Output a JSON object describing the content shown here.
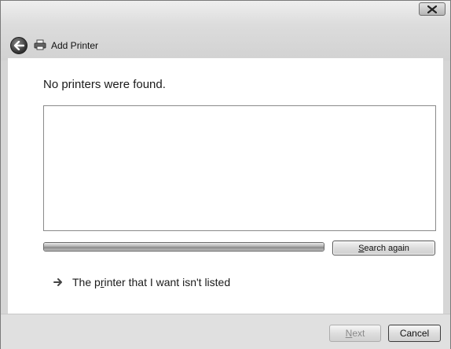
{
  "window": {
    "title": "Add Printer"
  },
  "titlebar": {
    "close_icon": "close-icon",
    "back_icon": "back-arrow-icon",
    "printer_icon": "printer-icon"
  },
  "main": {
    "heading": "No printers were found.",
    "search_button_label": "Search again",
    "search_button_accel": "S",
    "search_button_rest": "earch again",
    "link_text": "The printer that I want isn't listed",
    "link_pre": "The p",
    "link_accel": "r",
    "link_post": "inter that I want isn't listed",
    "progress": 1.0
  },
  "footer": {
    "next_label": "Next",
    "next_accel": "N",
    "next_rest": "ext",
    "cancel_label": "Cancel"
  }
}
